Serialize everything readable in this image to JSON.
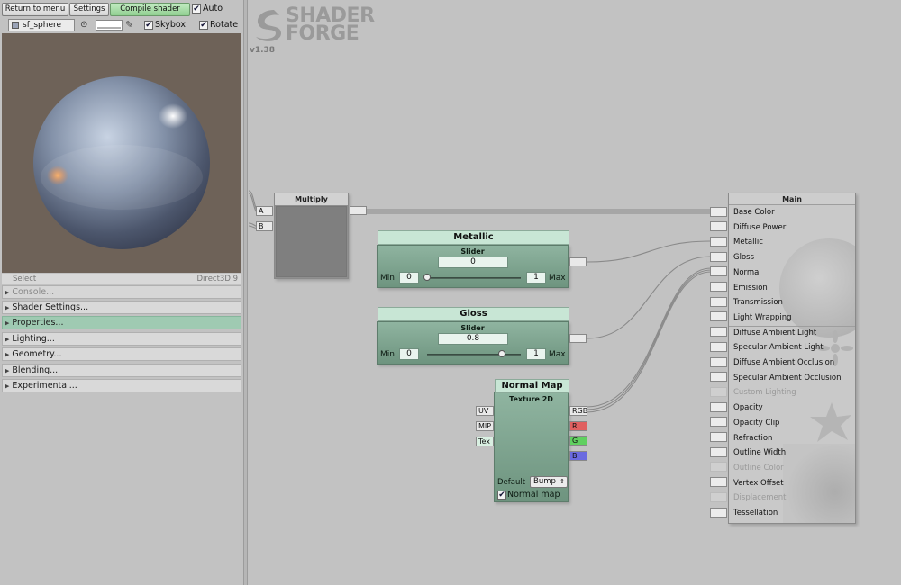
{
  "toolbar": {
    "return_label": "Return to menu",
    "settings_label": "Settings",
    "compile_label": "Compile shader",
    "auto_label": "Auto",
    "auto_checked": "✔"
  },
  "preview_bar": {
    "mesh_label": "sf_sphere",
    "skybox_label": "Skybox",
    "rotate_label": "Rotate",
    "check": "✔"
  },
  "statusbar": {
    "select_label": "Select",
    "renderer": "Direct3D 9"
  },
  "accordion": [
    {
      "label": "Console..."
    },
    {
      "label": "Shader Settings..."
    },
    {
      "label": "Properties..."
    },
    {
      "label": "Lighting..."
    },
    {
      "label": "Geometry..."
    },
    {
      "label": "Blending..."
    },
    {
      "label": "Experimental..."
    }
  ],
  "logo": {
    "line1": "SHADER",
    "line2": "FORGE",
    "version": "v1.38"
  },
  "multiply_node": {
    "title": "Multiply",
    "port_a": "A",
    "port_b": "B"
  },
  "metallic_node": {
    "title": "Metallic",
    "subtitle": "Slider",
    "value": "0",
    "min_label": "Min",
    "min": "0",
    "max": "1",
    "max_label": "Max",
    "slider_fraction": 0
  },
  "gloss_node": {
    "title": "Gloss",
    "subtitle": "Slider",
    "value": "0.8",
    "min_label": "Min",
    "min": "0",
    "max": "1",
    "max_label": "Max",
    "slider_fraction": 0.8
  },
  "normal_map_node": {
    "title": "Normal Map",
    "subtitle": "Texture 2D",
    "inputs": [
      "UV",
      "MIP",
      "Tex"
    ],
    "outputs": [
      "RGB",
      "R",
      "G",
      "B"
    ],
    "output_colors": [
      "#e9e9e9",
      "#e06060",
      "#60d060",
      "#6a6ae0"
    ],
    "default_label": "Default",
    "default_value": "Bump",
    "normal_map_checkbox_label": "Normal map",
    "check": "✔"
  },
  "main_node": {
    "title": "Main",
    "inputs": [
      {
        "label": "Base Color",
        "enabled": true
      },
      {
        "label": "Diffuse Power",
        "enabled": true
      },
      {
        "label": "Metallic",
        "enabled": true
      },
      {
        "label": "Gloss",
        "enabled": true
      },
      {
        "label": "Normal",
        "enabled": true
      },
      {
        "label": "Emission",
        "enabled": true
      },
      {
        "label": "Transmission",
        "enabled": true
      },
      {
        "label": "Light Wrapping",
        "enabled": true
      },
      {
        "label": "Diffuse Ambient Light",
        "enabled": true
      },
      {
        "label": "Specular Ambient Light",
        "enabled": true
      },
      {
        "label": "Diffuse Ambient Occlusion",
        "enabled": true
      },
      {
        "label": "Specular Ambient Occlusion",
        "enabled": true
      },
      {
        "label": "Custom Lighting",
        "enabled": false
      },
      {
        "label": "Opacity",
        "enabled": true
      },
      {
        "label": "Opacity Clip",
        "enabled": true
      },
      {
        "label": "Refraction",
        "enabled": true
      },
      {
        "label": "Outline Width",
        "enabled": true
      },
      {
        "label": "Outline Color",
        "enabled": false
      },
      {
        "label": "Vertex Offset",
        "enabled": true
      },
      {
        "label": "Displacement",
        "enabled": false
      },
      {
        "label": "Tessellation",
        "enabled": true
      }
    ]
  },
  "colors": {
    "canvas": "#c2c2c2",
    "node_green": "#7fa590",
    "node_green_title": "#c8e6d5",
    "accordion_active": "#9fcab2",
    "preview_bg": "#6e6258"
  },
  "icons": {
    "eyedropper": "eyedropper-icon",
    "mesh_picker": "mesh-picker-icon",
    "target": "target-icon",
    "dropdown": "dropdown-arrows-icon"
  }
}
